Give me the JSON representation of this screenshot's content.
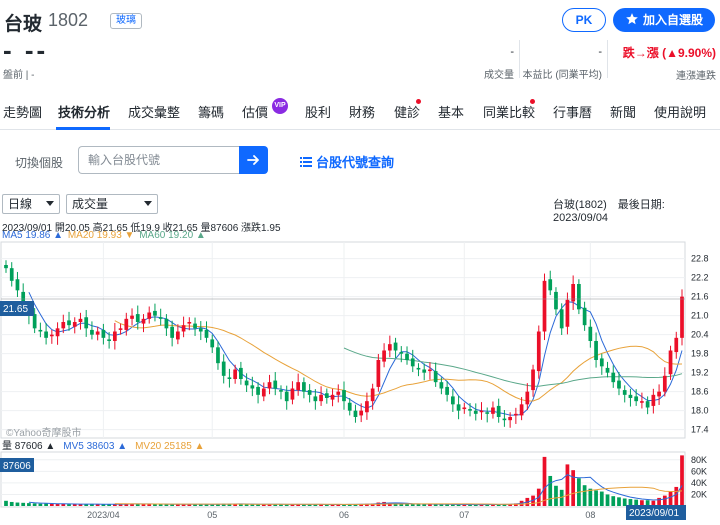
{
  "header": {
    "name": "台玻",
    "code": "1802",
    "tag": "玻璃",
    "pk": "PK",
    "watch": "加入自選股",
    "price": "- --",
    "session": "盤前 | -",
    "volume": {
      "value": "-",
      "label": "成交量"
    },
    "ratio": {
      "value": "-",
      "label": "本益比 (同業平均)"
    },
    "streak": {
      "value": "跌→漲 (▲9.90%)",
      "label": "連漲連跌"
    }
  },
  "nav": {
    "items": [
      "走勢圖",
      "技術分析",
      "成交彙整",
      "籌碼",
      "估價",
      "股利",
      "財務",
      "健診",
      "基本",
      "同業比較",
      "行事曆",
      "新聞",
      "使用說明"
    ],
    "vip": "VIP"
  },
  "search": {
    "label": "切換個股",
    "placeholder": "輸入台股代號",
    "lookup": "台股代號查詢"
  },
  "controls": {
    "period": "日線",
    "indicator": "成交量",
    "last_date": "台玻(1802)　最後日期: 2023/09/04"
  },
  "info": {
    "ohlc": "2023/09/01 開20.05 高21.65 低19.9 收21.65 量87606 漲跌1.95",
    "ma5": "MA5 19.86 ▲",
    "ma20": "MA20 19.93 ▼",
    "ma60": "MA60 19.20 ▲",
    "vol_row": {
      "vol": "量 87606 ▲",
      "mv5": "MV5 38603 ▲",
      "mv20": "MV20 25185 ▲"
    }
  },
  "colors": {
    "up": "#eb0f29",
    "down": "#00a05a",
    "accent": "#0f69ff",
    "ma5": "#2c6ad8",
    "ma20": "#e8a23a",
    "ma60": "#5aa88a"
  },
  "chart_data": {
    "type": "candlestick",
    "watermark": "©Yahoo奇摩股市",
    "price_label": "21.65",
    "volume_label": "87606",
    "date_label": "2023/09/01",
    "y_ticks": [
      22.8,
      22.2,
      21.6,
      21.0,
      20.4,
      19.8,
      19.2,
      18.6,
      18.0,
      17.4
    ],
    "ylim": [
      17.2,
      23.2
    ],
    "vol_ticks": [
      "80K",
      "60K",
      "40K",
      "20K"
    ],
    "vol_max": 90000,
    "x_ticks": [
      "2023/04",
      "05",
      "06",
      "07",
      "08"
    ],
    "x_tick_index": [
      17,
      36,
      59,
      80,
      102
    ],
    "closes": [
      22.5,
      22.1,
      21.8,
      21.3,
      21.0,
      20.6,
      20.5,
      20.3,
      20.4,
      20.6,
      20.8,
      20.7,
      20.8,
      20.9,
      20.6,
      20.4,
      20.5,
      20.3,
      20.2,
      20.5,
      20.6,
      20.9,
      21.0,
      20.8,
      20.9,
      21.1,
      21.0,
      20.9,
      20.6,
      20.3,
      20.5,
      20.7,
      20.8,
      20.6,
      20.5,
      20.3,
      20.0,
      19.5,
      19.1,
      19.0,
      19.3,
      19.0,
      18.8,
      18.7,
      18.5,
      18.7,
      18.9,
      18.7,
      18.6,
      18.3,
      18.7,
      18.9,
      18.6,
      18.5,
      18.3,
      18.5,
      18.4,
      18.5,
      18.6,
      18.3,
      18.0,
      17.8,
      18.0,
      18.3,
      18.7,
      19.6,
      19.9,
      20.1,
      19.9,
      19.8,
      19.6,
      19.4,
      19.3,
      19.2,
      19.3,
      18.9,
      18.7,
      18.5,
      18.2,
      18.0,
      18.1,
      18.0,
      17.9,
      18.0,
      17.9,
      18.1,
      17.8,
      17.7,
      17.8,
      17.9,
      18.2,
      18.6,
      19.3,
      20.5,
      22.1,
      21.8,
      21.2,
      20.6,
      21.5,
      22.0,
      21.2,
      20.7,
      20.2,
      19.6,
      19.4,
      19.2,
      18.9,
      18.7,
      18.5,
      18.4,
      18.3,
      18.3,
      18.1,
      18.5,
      18.6,
      19.1,
      19.9,
      20.3,
      21.6
    ],
    "volumes": [
      9000,
      7000,
      6000,
      5500,
      5000,
      4500,
      4000,
      4200,
      3800,
      3500,
      3600,
      3300,
      3000,
      3200,
      3400,
      3600,
      3000,
      2800,
      3100,
      3300,
      3600,
      4000,
      3800,
      3500,
      3400,
      3300,
      3600,
      3200,
      3000,
      2800,
      3100,
      3400,
      3000,
      2900,
      2700,
      2600,
      3000,
      3300,
      4000,
      3800,
      3500,
      3200,
      3000,
      2900,
      3100,
      2800,
      3000,
      2800,
      2600,
      2500,
      2800,
      3000,
      2800,
      2600,
      2500,
      2700,
      2600,
      2800,
      2700,
      2600,
      2900,
      3100,
      3500,
      3800,
      4200,
      6000,
      7000,
      5000,
      4200,
      3800,
      3500,
      3300,
      3200,
      3000,
      3100,
      3000,
      2800,
      2600,
      2500,
      2400,
      2600,
      2500,
      2400,
      2500,
      2600,
      2800,
      3000,
      3200,
      3500,
      4500,
      9000,
      14000,
      18000,
      30000,
      85000,
      52000,
      35000,
      28000,
      72000,
      62000,
      48000,
      36000,
      30000,
      27000,
      25000,
      20000,
      17000,
      15000,
      13000,
      12000,
      11000,
      10000,
      10000,
      9000,
      14000,
      18000,
      25000,
      33000,
      87606
    ]
  }
}
